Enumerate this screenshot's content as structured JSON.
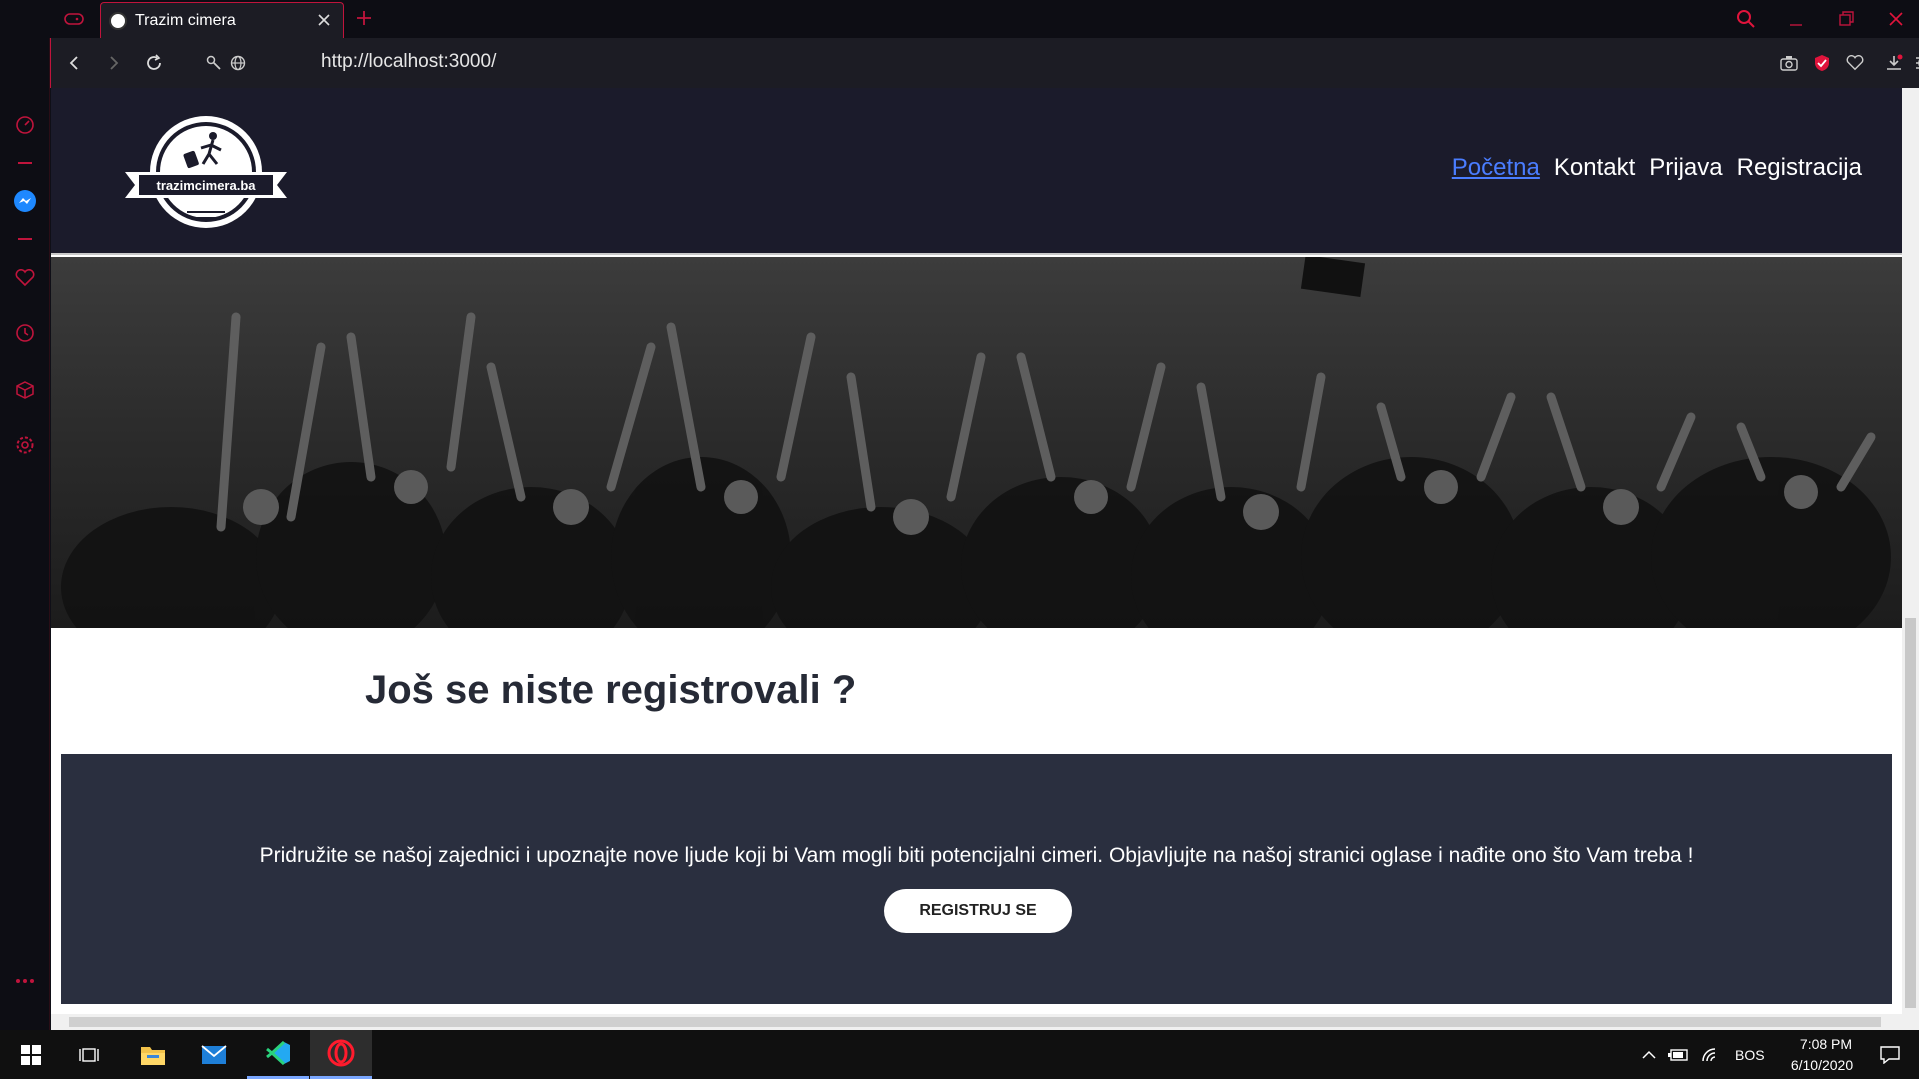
{
  "browser": {
    "tab": {
      "title": "Trazim cimera"
    },
    "address": {
      "url": "http://localhost:3000/"
    },
    "sidebar_icons": [
      "opera-logo-icon",
      "speed-dial-icon",
      "messenger-icon",
      "heart-icon",
      "history-icon",
      "box-icon",
      "settings-icon",
      "more-icon"
    ],
    "accent": "#c0143c"
  },
  "site": {
    "logo_text": "trazimcimera.ba",
    "nav": {
      "home": "Početna",
      "contact": "Kontakt",
      "login": "Prijava",
      "register": "Registracija"
    },
    "cta": {
      "title": "Još se niste registrovali ?",
      "text": "Pridružite se našoj zajednici i upoznajte nove ljude koji bi Vam mogli biti potencijalni cimeri. Objavljujte na našoj stranici oglase i nađite ono što Vam treba !",
      "button": "REGISTRUJ SE"
    },
    "colors": {
      "header_bg": "#1b1b2b",
      "panel_bg": "#2a2f3f",
      "active_link": "#4a7dff"
    }
  },
  "taskbar": {
    "apps": [
      "windows-start-icon",
      "task-view-icon",
      "file-explorer-icon",
      "mail-icon",
      "vscode-icon",
      "opera-icon"
    ],
    "language": "BOS",
    "time": "7:08 PM",
    "date": "6/10/2020"
  }
}
